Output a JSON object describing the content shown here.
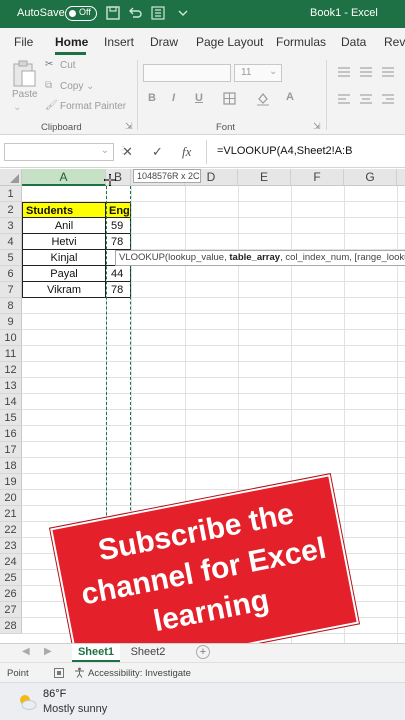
{
  "titlebar": {
    "autosave_label": "AutoSave",
    "autosave_state": "Off",
    "document_title": "Book1  -  Excel",
    "accent": "#1e7145"
  },
  "tabs": [
    "File",
    "Home",
    "Insert",
    "Draw",
    "Page Layout",
    "Formulas",
    "Data",
    "Revi"
  ],
  "active_tab": "Home",
  "clipboard": {
    "paste": "Paste",
    "cut": "Cut",
    "copy": "Copy",
    "format_painter": "Format Painter",
    "group_label": "Clipboard"
  },
  "font": {
    "font_size": "11",
    "group_label": "Font",
    "bold": "B",
    "italic": "I",
    "underline": "U"
  },
  "formula_bar": {
    "cancel_icon": "✕",
    "enter_icon": "✓",
    "function_icon": "fx",
    "formula": "=VLOOKUP(A4,Sheet2!A:B"
  },
  "grid": {
    "columns": [
      "A",
      "B",
      "D",
      "E",
      "F",
      "G"
    ],
    "rows": [
      "1",
      "2",
      "3",
      "4",
      "5",
      "6",
      "7",
      "8",
      "9",
      "10",
      "11",
      "12",
      "13",
      "14",
      "15",
      "16",
      "17",
      "18",
      "19",
      "20",
      "21",
      "22",
      "23",
      "24",
      "25",
      "26",
      "27",
      "28"
    ],
    "table_headers": [
      "Students Name",
      "Eng"
    ],
    "table_rows": [
      [
        "Anil",
        "59"
      ],
      [
        "Hetvi",
        "78"
      ],
      [
        "Kinjal",
        ""
      ],
      [
        "Payal",
        "44"
      ],
      [
        "Vikram",
        "78"
      ]
    ],
    "range_tooltip": "1048576R x 2C",
    "func_tooltip_prefix": "VLOOKUP(lookup_value, ",
    "func_tooltip_bold": "table_array",
    "func_tooltip_suffix": ", col_index_num, [range_lookup])"
  },
  "banner": {
    "line1": "Subscribe the",
    "line2": "channel for Excel",
    "line3": "learning",
    "color": "#e4202a"
  },
  "sheets": {
    "active": "Sheet1",
    "other": "Sheet2",
    "add_icon": "+"
  },
  "status": {
    "mode": "Point",
    "accessibility": "Accessibility: Investigate"
  },
  "taskbar": {
    "temperature": "86°F",
    "condition": "Mostly sunny"
  }
}
